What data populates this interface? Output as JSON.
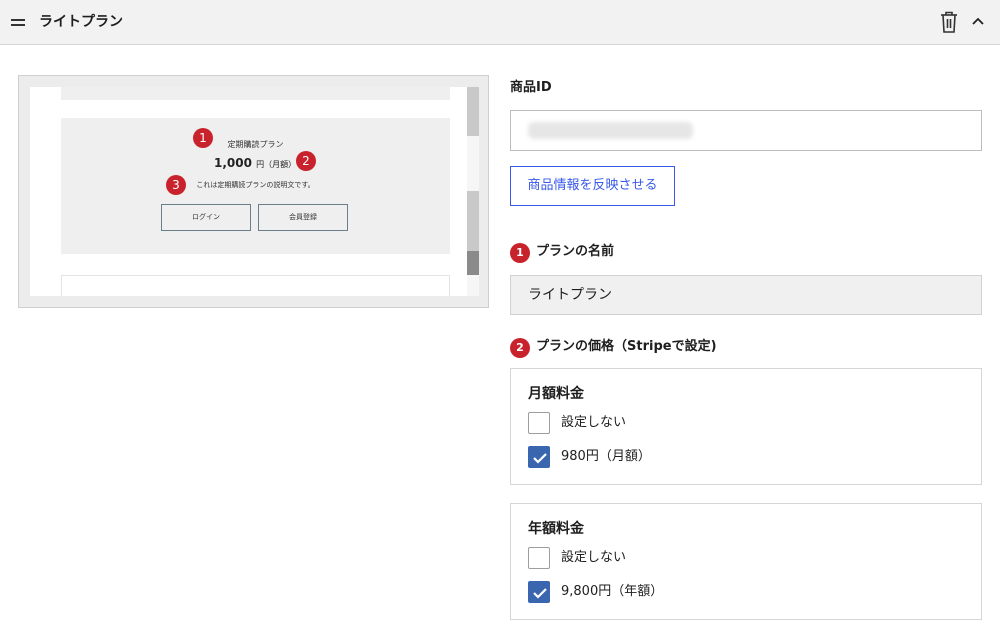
{
  "header": {
    "title": "ライトプラン",
    "icons": [
      "menu-icon",
      "trash-icon",
      "chevron-up-icon"
    ]
  },
  "preview": {
    "plan_name": "定期購読プラン",
    "price": "1,000",
    "price_suffix": "円（月額）",
    "description": "これは定期購読プランの説明文です。",
    "login_label": "ログイン",
    "signup_label": "会員登録",
    "badges": [
      "1",
      "2",
      "3"
    ]
  },
  "product": {
    "id_label": "商品ID",
    "reflect_button_label": "商品情報を反映させる"
  },
  "plan_name_section": {
    "badge": "1",
    "label": "プランの名前",
    "value": "ライトプラン"
  },
  "plan_price_section": {
    "badge": "2",
    "label": "プランの価格（Stripeで設定)"
  },
  "monthly": {
    "title": "月額料金",
    "options": [
      {
        "label": "設定しない",
        "checked": false
      },
      {
        "label": "980円（月額）",
        "checked": true
      }
    ]
  },
  "yearly": {
    "title": "年額料金",
    "options": [
      {
        "label": "設定しない",
        "checked": false
      },
      {
        "label": "9,800円（年額）",
        "checked": true
      }
    ]
  },
  "colors": {
    "accent": "#3858e9",
    "badge": "#c8232c",
    "checkbox_checked": "#3a66b0"
  }
}
